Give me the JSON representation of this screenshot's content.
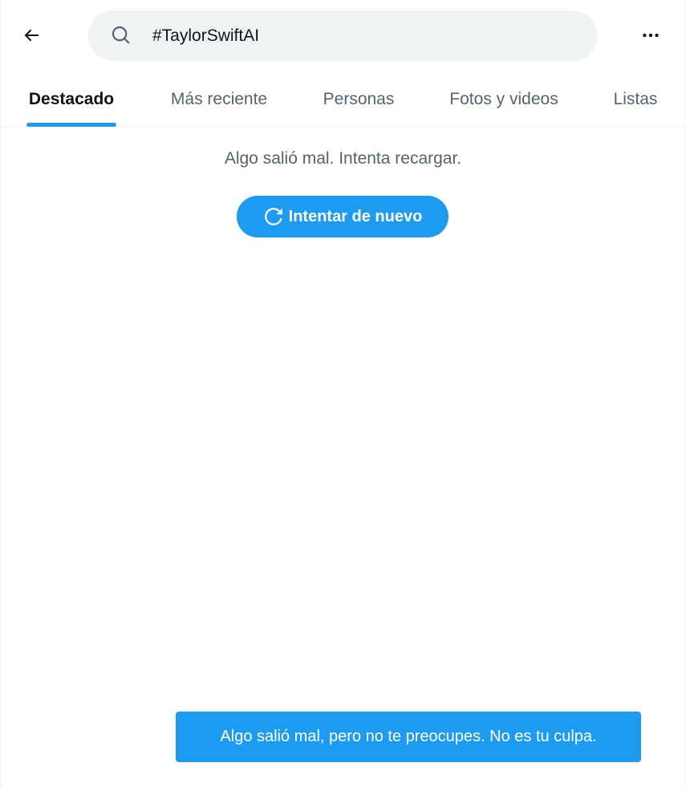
{
  "header": {
    "back_icon": "arrow-left-icon",
    "search": {
      "icon": "search-icon",
      "value": "#TaylorSwiftAI"
    },
    "more_icon": "more-horizontal-icon"
  },
  "tabs": [
    {
      "label": "Destacado",
      "active": true
    },
    {
      "label": "Más reciente",
      "active": false
    },
    {
      "label": "Personas",
      "active": false
    },
    {
      "label": "Fotos y videos",
      "active": false
    },
    {
      "label": "Listas",
      "active": false
    }
  ],
  "error": {
    "message": "Algo salió mal. Intenta recargar.",
    "retry_label": "Intentar de nuevo",
    "retry_icon": "refresh-icon"
  },
  "toast": {
    "message": "Algo salió mal, pero no te preocupes. No es tu culpa."
  },
  "colors": {
    "accent": "#1d9bf0",
    "text_primary": "#0f1419",
    "text_secondary": "#536471",
    "search_bg": "#eff3f4"
  }
}
